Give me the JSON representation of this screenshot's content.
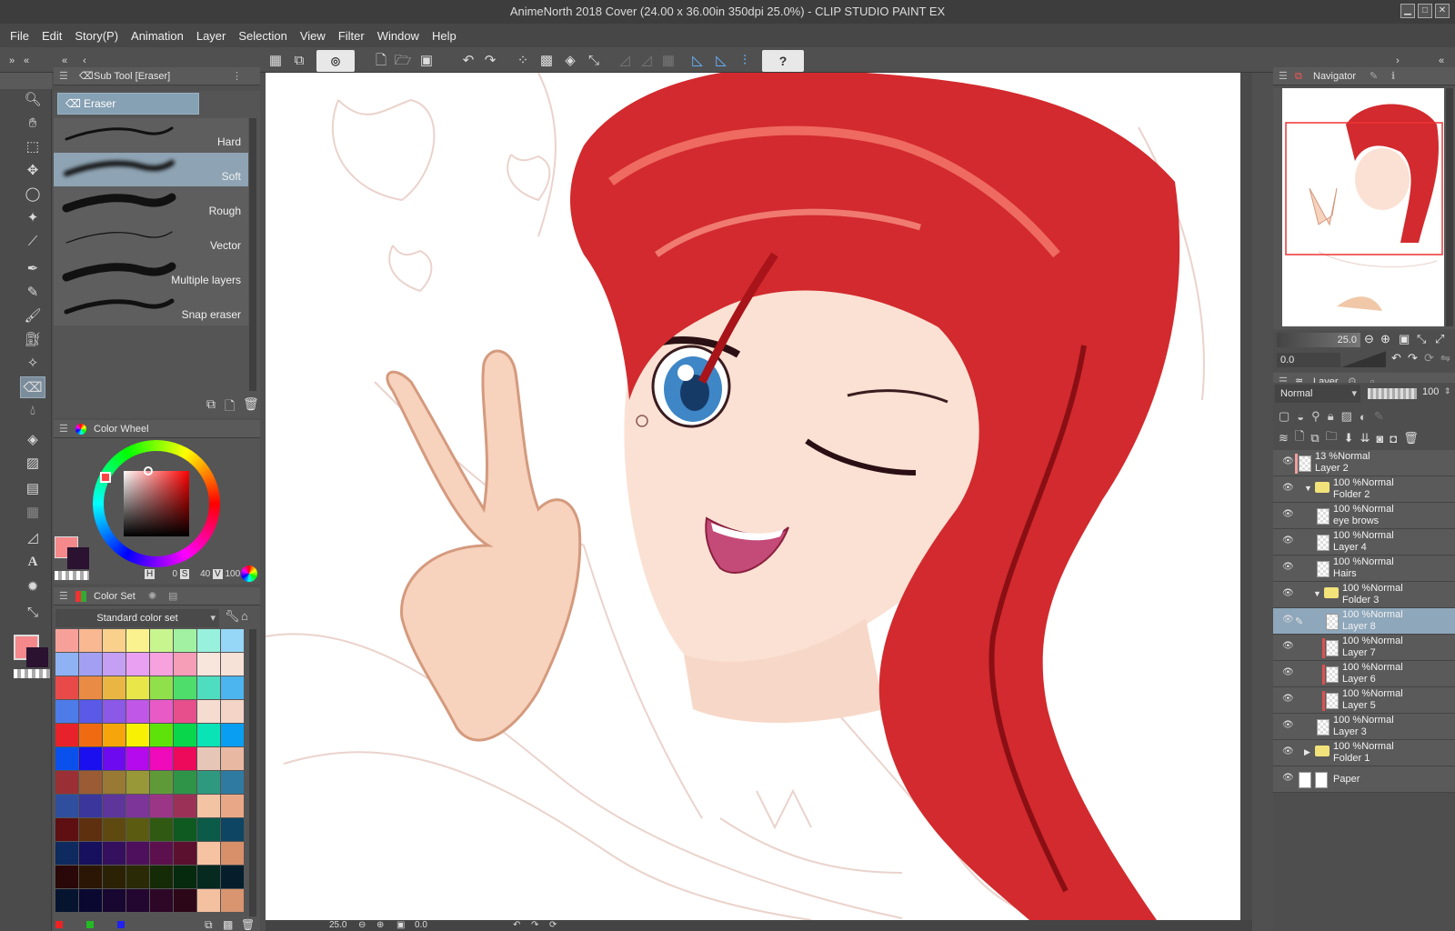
{
  "window": {
    "title": "AnimeNorth 2018 Cover (24.00 x 36.00in 350dpi 25.0%)  - CLIP STUDIO PAINT EX"
  },
  "menu": [
    "File",
    "Edit",
    "Story(P)",
    "Animation",
    "Layer",
    "Selection",
    "View",
    "Filter",
    "Window",
    "Help"
  ],
  "subtool": {
    "tab": "Sub Tool [Eraser]",
    "group": "Eraser",
    "items": [
      "Hard",
      "Soft",
      "Rough",
      "Vector",
      "Multiple layers",
      "Snap eraser"
    ],
    "selected": "Soft"
  },
  "colorwheel": {
    "tab": "Color Wheel",
    "h": "0",
    "s": "40",
    "v": "100",
    "main_color": "#f4888a",
    "sub_color": "#2a1230"
  },
  "colorset": {
    "tab": "Color Set",
    "set_name": "Standard color set",
    "rows": [
      [
        "#f7a09a",
        "#f9b891",
        "#fad08d",
        "#faf28e",
        "#c9f58f",
        "#a2f0a2",
        "#97f1dc",
        "#96d6f6"
      ],
      [
        "#8fb2f5",
        "#a3a0f4",
        "#c59ff4",
        "#e9a0f3",
        "#f7a2de",
        "#f69db8",
        "#f8e6dc",
        "#f7e2d8"
      ],
      [
        "#e84a4a",
        "#ea8b45",
        "#e9b643",
        "#e8e648",
        "#90e04b",
        "#4edc6a",
        "#4fddbf",
        "#4cb4ef"
      ],
      [
        "#4d7be8",
        "#5a59e8",
        "#8c58e8",
        "#c057e6",
        "#e85bc6",
        "#e64f8b",
        "#f5dcd1",
        "#f3d4c7"
      ],
      [
        "#e8222a",
        "#f06a12",
        "#f6a60a",
        "#f8f104",
        "#5ee30a",
        "#0ad64c",
        "#09e3b5",
        "#0a9ef2"
      ],
      [
        "#0a50ec",
        "#1b0ff0",
        "#6e0af0",
        "#b509ee",
        "#ef0aba",
        "#ee0a5a",
        "#e6c6b6",
        "#e8b8a2"
      ],
      [
        "#9a3036",
        "#9b5c35",
        "#987a34",
        "#999838",
        "#609a38",
        "#2f9447",
        "#2e997e",
        "#2e7aa0"
      ],
      [
        "#2f4f9e",
        "#3a369c",
        "#5d359b",
        "#7d359a",
        "#9b3686",
        "#9a3258",
        "#f3c4a3",
        "#e8a888"
      ],
      [
        "#5d0f12",
        "#5e3010",
        "#5e4a10",
        "#5c5b12",
        "#305a12",
        "#0e5a20",
        "#0c5a48",
        "#0d4562"
      ],
      [
        "#0f2a5e",
        "#16105e",
        "#35105e",
        "#4e105d",
        "#5c104e",
        "#5c1030",
        "#f6c3a2",
        "#d8906a"
      ],
      [
        "#2a0708",
        "#2b1606",
        "#2b2206",
        "#2a2a07",
        "#152a06",
        "#062a0e",
        "#062a20",
        "#061e2c"
      ],
      [
        "#061430",
        "#0a0730",
        "#180730",
        "#240730",
        "#2c0726",
        "#2c0718",
        "#f3c0a0",
        "#d89570"
      ]
    ]
  },
  "navigator": {
    "tab": "Navigator",
    "zoom": "25.0",
    "angle": "0.0"
  },
  "layers": {
    "tab": "Layer",
    "blend": "Normal",
    "opacity": "100",
    "items": [
      {
        "t1": "13 %Normal",
        "t2": "Layer 2",
        "indent": 0,
        "folder": false,
        "sel": false,
        "swatch": "#f0a0a0"
      },
      {
        "t1": "100 %Normal",
        "t2": "Folder 2",
        "indent": 1,
        "folder": true,
        "sel": false,
        "swatch": ""
      },
      {
        "t1": "100 %Normal",
        "t2": "eye brows",
        "indent": 2,
        "folder": false,
        "sel": false,
        "swatch": ""
      },
      {
        "t1": "100 %Normal",
        "t2": "Layer 4",
        "indent": 2,
        "folder": false,
        "sel": false,
        "swatch": ""
      },
      {
        "t1": "100 %Normal",
        "t2": "Hairs",
        "indent": 2,
        "folder": false,
        "sel": false,
        "swatch": ""
      },
      {
        "t1": "100 %Normal",
        "t2": "Folder 3",
        "indent": 2,
        "folder": true,
        "sel": false,
        "swatch": ""
      },
      {
        "t1": "100 %Normal",
        "t2": "Layer 8",
        "indent": 3,
        "folder": false,
        "sel": true,
        "swatch": ""
      },
      {
        "t1": "100 %Normal",
        "t2": "Layer 7",
        "indent": 3,
        "folder": false,
        "sel": false,
        "swatch": "#e05050"
      },
      {
        "t1": "100 %Normal",
        "t2": "Layer 6",
        "indent": 3,
        "folder": false,
        "sel": false,
        "swatch": "#e05050"
      },
      {
        "t1": "100 %Normal",
        "t2": "Layer 5",
        "indent": 3,
        "folder": false,
        "sel": false,
        "swatch": "#e05050"
      },
      {
        "t1": "100 %Normal",
        "t2": "Layer 3",
        "indent": 2,
        "folder": false,
        "sel": false,
        "swatch": ""
      },
      {
        "t1": "100 %Normal",
        "t2": "Folder 1",
        "indent": 1,
        "folder": true,
        "sel": false,
        "swatch": ""
      },
      {
        "t1": "",
        "t2": "Paper",
        "indent": 0,
        "folder": false,
        "sel": false,
        "swatch": ""
      }
    ]
  },
  "status": {
    "zoom": "25.0",
    "angle": "0.0"
  }
}
